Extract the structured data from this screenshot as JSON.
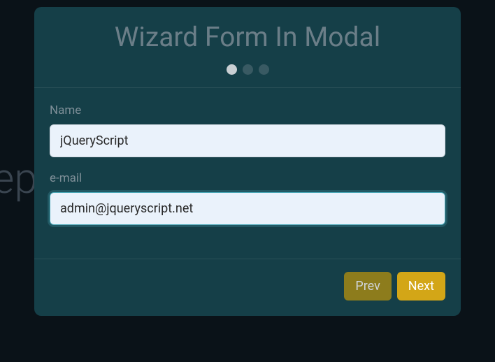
{
  "background_text": "tep",
  "modal": {
    "title": "Wizard Form In Modal",
    "steps": {
      "total": 3,
      "active_index": 0
    },
    "fields": {
      "name": {
        "label": "Name",
        "value": "jQueryScript"
      },
      "email": {
        "label": "e-mail",
        "value": "admin@jqueryscript.net"
      }
    },
    "buttons": {
      "prev": "Prev",
      "next": "Next"
    }
  }
}
